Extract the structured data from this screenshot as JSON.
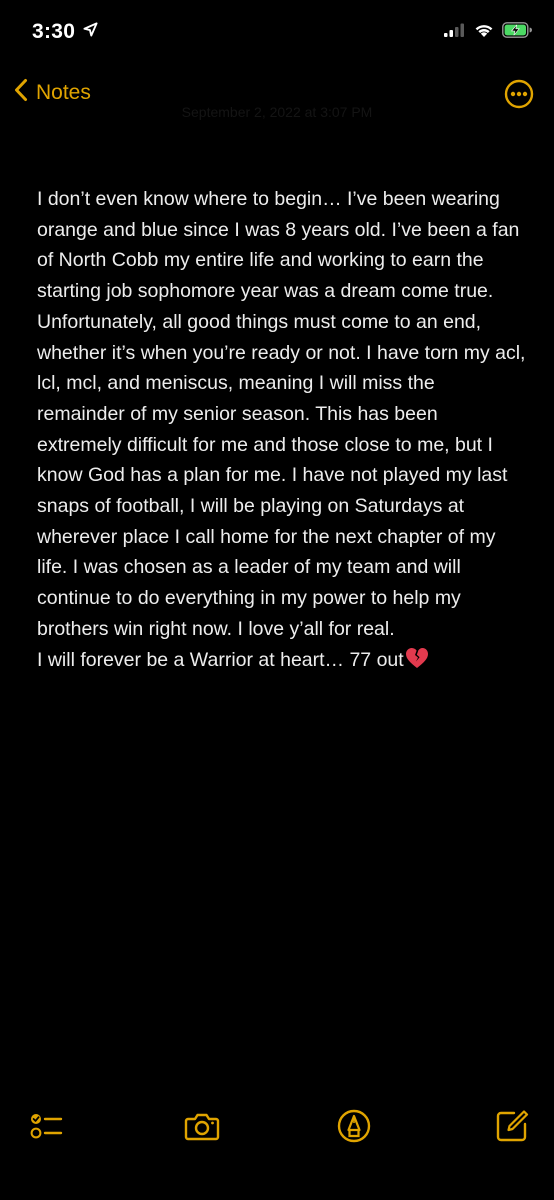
{
  "status_bar": {
    "time": "3:30",
    "location_icon": "location-arrow-icon",
    "signal_icon": "cellular-signal-icon",
    "wifi_icon": "wifi-icon",
    "battery_icon": "battery-charging-icon",
    "battery_color": "#4cd964"
  },
  "nav": {
    "back_label": "Notes",
    "back_icon": "chevron-left-icon",
    "date": "September 2, 2022 at 3:07 PM",
    "more_icon": "ellipsis-circle-icon",
    "accent_color": "#e0a400"
  },
  "note": {
    "body": "I don’t even know where to begin… I’ve been wearing orange and blue since I was 8 years old. I’ve been a fan of North Cobb my entire life and working to earn the starting job sophomore year was a dream come true. Unfortunately, all good things must come to an end, whether it’s when you’re ready or not. I have torn my acl, lcl, mcl, and meniscus, meaning I will miss the remainder of my senior season. This has been extremely difficult for me and those close to me, but I know God has a plan for me. I have not played my last snaps of football, I will be playing on Saturdays at wherever place I call home for the next chapter of my life. I was chosen as a leader of my team and will continue to do everything in my power to help my brothers win right now. I love y’all for real.",
    "closing": "I will forever be a Warrior at heart… 77 out",
    "closing_emoji_icon": "broken-heart-icon"
  },
  "toolbar": {
    "checklist_icon": "checklist-icon",
    "camera_icon": "camera-icon",
    "markup_icon": "markup-pen-icon",
    "compose_icon": "compose-icon"
  }
}
